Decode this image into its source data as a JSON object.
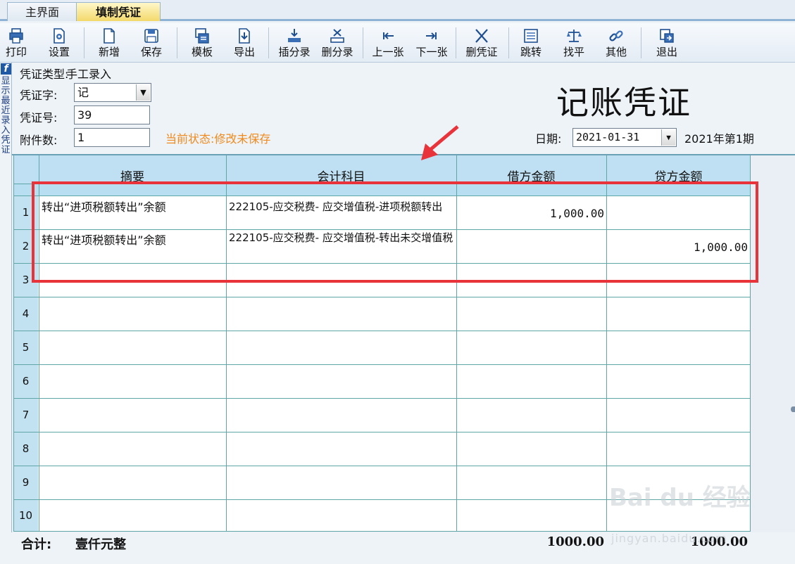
{
  "tabs": {
    "main": "主界面",
    "voucher": "填制凭证"
  },
  "toolbar": [
    {
      "id": "print",
      "label": "打印",
      "icon": "printer-icon"
    },
    {
      "id": "settings",
      "label": "设置",
      "icon": "gear-icon"
    },
    {
      "id": "new",
      "label": "新增",
      "icon": "new-page-icon"
    },
    {
      "id": "save",
      "label": "保存",
      "icon": "floppy-icon"
    },
    {
      "id": "template",
      "label": "模板",
      "icon": "template-icon"
    },
    {
      "id": "export",
      "label": "导出",
      "icon": "export-icon"
    },
    {
      "id": "insert-entry",
      "label": "插分录",
      "icon": "insert-row-icon"
    },
    {
      "id": "delete-entry",
      "label": "删分录",
      "icon": "delete-row-icon"
    },
    {
      "id": "prev",
      "label": "上一张",
      "icon": "prev-icon"
    },
    {
      "id": "next",
      "label": "下一张",
      "icon": "next-icon"
    },
    {
      "id": "delete-voucher",
      "label": "删凭证",
      "icon": "close-icon"
    },
    {
      "id": "jump",
      "label": "跳转",
      "icon": "jump-icon"
    },
    {
      "id": "balance",
      "label": "找平",
      "icon": "scale-icon"
    },
    {
      "id": "other",
      "label": "其他",
      "icon": "link-icon"
    },
    {
      "id": "exit",
      "label": "退出",
      "icon": "exit-icon"
    }
  ],
  "side_panel": {
    "label": "显示最近录入凭证"
  },
  "header": {
    "voucher_type_label": "凭证类型:",
    "voucher_type_value": "手工录入",
    "voucher_word_label": "凭证字:",
    "voucher_word_value": "记",
    "voucher_no_label": "凭证号:",
    "voucher_no_value": "39",
    "attachments_label": "附件数:",
    "attachments_value": "1",
    "status": "当前状态:修改未保存",
    "title": "记账凭证",
    "date_label": "日期:",
    "date_value": "2021-01-31",
    "period": "2021年第1期"
  },
  "table": {
    "columns": [
      "摘要",
      "会计科目",
      "借方金额",
      "贷方金额"
    ],
    "rows": [
      {
        "no": "1",
        "summary": "转出“进项税额转出”余额",
        "account": "222105-应交税费- 应交增值税-进项税额转出",
        "debit": "1,000.00",
        "credit": ""
      },
      {
        "no": "2",
        "summary": "转出“进项税额转出”余额",
        "account": "222105-应交税费-  应交增值税-转出未交增值税",
        "debit": "",
        "credit": "1,000.00"
      },
      {
        "no": "3",
        "summary": "",
        "account": "",
        "debit": "",
        "credit": ""
      },
      {
        "no": "4",
        "summary": "",
        "account": "",
        "debit": "",
        "credit": ""
      },
      {
        "no": "5",
        "summary": "",
        "account": "",
        "debit": "",
        "credit": ""
      },
      {
        "no": "6",
        "summary": "",
        "account": "",
        "debit": "",
        "credit": ""
      },
      {
        "no": "7",
        "summary": "",
        "account": "",
        "debit": "",
        "credit": ""
      },
      {
        "no": "8",
        "summary": "",
        "account": "",
        "debit": "",
        "credit": ""
      },
      {
        "no": "9",
        "summary": "",
        "account": "",
        "debit": "",
        "credit": ""
      },
      {
        "no": "10",
        "summary": "",
        "account": "",
        "debit": "",
        "credit": ""
      }
    ]
  },
  "totals": {
    "label": "合计:",
    "amount_in_words": "壹仟元整",
    "debit_total": "1000.00",
    "credit_total": "1000.00"
  },
  "watermark": {
    "text": "Bai du 经验",
    "url_text": "jingyan.baidu.com"
  },
  "colors": {
    "highlight": "#e8333a",
    "status": "#f08a1c",
    "grid_line": "#5fa6a6",
    "header_bg": "#bfe0f2"
  }
}
